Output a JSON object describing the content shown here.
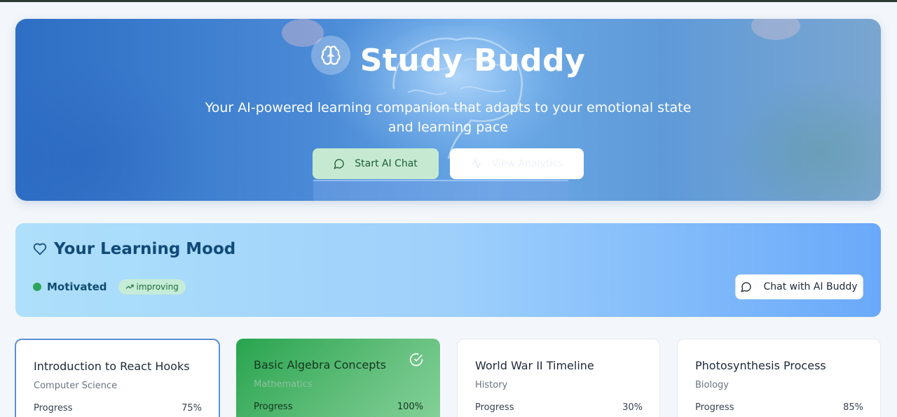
{
  "hero": {
    "title": "Study Buddy",
    "subtitle": "Your AI-powered learning companion that adapts to your emotional state and learning pace",
    "primary_button": "Start AI Chat",
    "secondary_button": "View Analytics"
  },
  "mood": {
    "title": "Your Learning Mood",
    "status": "Motivated",
    "trend": "improving",
    "chat_button": "Chat with AI Buddy",
    "status_color": "#2fa45c"
  },
  "courses": [
    {
      "title": "Introduction to React Hooks",
      "category": "Computer Science",
      "progress_label": "Progress",
      "progress": "75%",
      "state": "active"
    },
    {
      "title": "Basic Algebra Concepts",
      "category": "Mathematics",
      "progress_label": "Progress",
      "progress": "100%",
      "state": "completed"
    },
    {
      "title": "World War II Timeline",
      "category": "History",
      "progress_label": "Progress",
      "progress": "30%",
      "state": "default"
    },
    {
      "title": "Photosynthesis Process",
      "category": "Biology",
      "progress_label": "Progress",
      "progress": "85%",
      "state": "default"
    }
  ],
  "icons": {
    "brand": "brain-icon",
    "chat": "message-circle-icon",
    "analytics": "activity-icon",
    "mood": "heart-icon",
    "trend": "trending-up-icon",
    "completed": "check-circle-icon"
  },
  "colors": {
    "accent": "#2e6ec4",
    "success": "#28a44e"
  }
}
